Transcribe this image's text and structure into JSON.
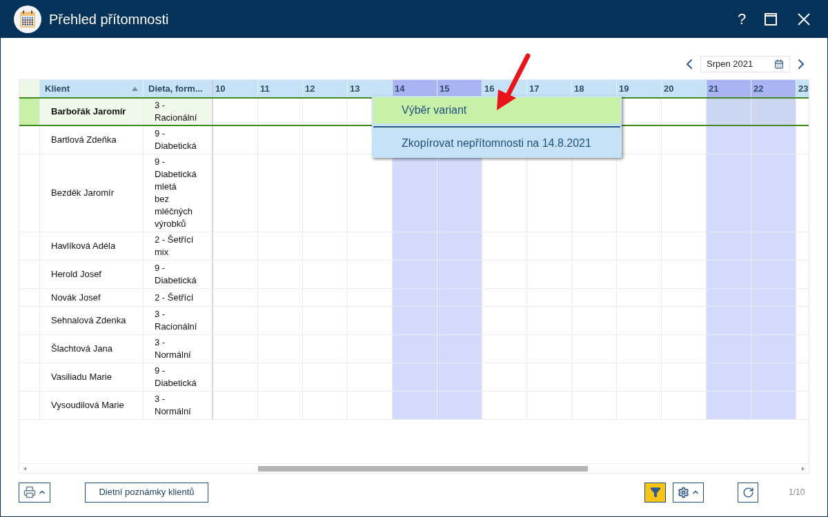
{
  "window": {
    "title": "Přehled přítomnosti",
    "help": "?"
  },
  "month_picker": {
    "value": "Srpen 2021"
  },
  "table": {
    "columns": [
      "Klient",
      "Dieta, form..."
    ],
    "days": [
      {
        "label": "10",
        "weekend": false
      },
      {
        "label": "11",
        "weekend": false
      },
      {
        "label": "12",
        "weekend": false
      },
      {
        "label": "13",
        "weekend": false
      },
      {
        "label": "14",
        "weekend": true
      },
      {
        "label": "15",
        "weekend": true
      },
      {
        "label": "16",
        "weekend": false
      },
      {
        "label": "17",
        "weekend": false
      },
      {
        "label": "18",
        "weekend": false
      },
      {
        "label": "19",
        "weekend": false
      },
      {
        "label": "20",
        "weekend": false
      },
      {
        "label": "21",
        "weekend": true
      },
      {
        "label": "22",
        "weekend": true
      },
      {
        "label": "23",
        "weekend": false
      }
    ],
    "rows": [
      {
        "name": "Barbořák Jaromír",
        "diet": [
          "3 -",
          "Racionální"
        ],
        "selected": true
      },
      {
        "name": "Bartlová Zdeňka",
        "diet": [
          "9 -",
          "Diabetická"
        ],
        "selected": false
      },
      {
        "name": "Bezděk Jaromír",
        "diet": [
          "9 -",
          "Diabetická",
          "mletá",
          "bez",
          "mléčných",
          "výrobků"
        ],
        "selected": false
      },
      {
        "name": "Havlíková Adéla",
        "diet": [
          "2 - Šetřící",
          "mix"
        ],
        "selected": false
      },
      {
        "name": "Herold Josef",
        "diet": [
          "9 -",
          "Diabetická"
        ],
        "selected": false
      },
      {
        "name": "Novák Josef",
        "diet": [
          "2 - Šetřící"
        ],
        "selected": false
      },
      {
        "name": "Sehnalová Zdenka",
        "diet": [
          "3 -",
          "Racionální"
        ],
        "selected": false
      },
      {
        "name": "Šlachtová Jana",
        "diet": [
          "3 -",
          "Normální"
        ],
        "selected": false
      },
      {
        "name": "Vasiliadu Marie",
        "diet": [
          "9 -",
          "Diabetická"
        ],
        "selected": false
      },
      {
        "name": "Vysoudilová Marie",
        "diet": [
          "3 -",
          "Normální"
        ],
        "selected": false
      }
    ]
  },
  "context_menu": [
    {
      "label": "Výběr variant",
      "selected": true
    },
    {
      "label": "Zkopírovat nepřítomnosti na 14.8.2021",
      "selected": false
    }
  ],
  "footer": {
    "notes_button": "Dietní poznámky klientů",
    "filter_active": true,
    "page": "1/10"
  }
}
